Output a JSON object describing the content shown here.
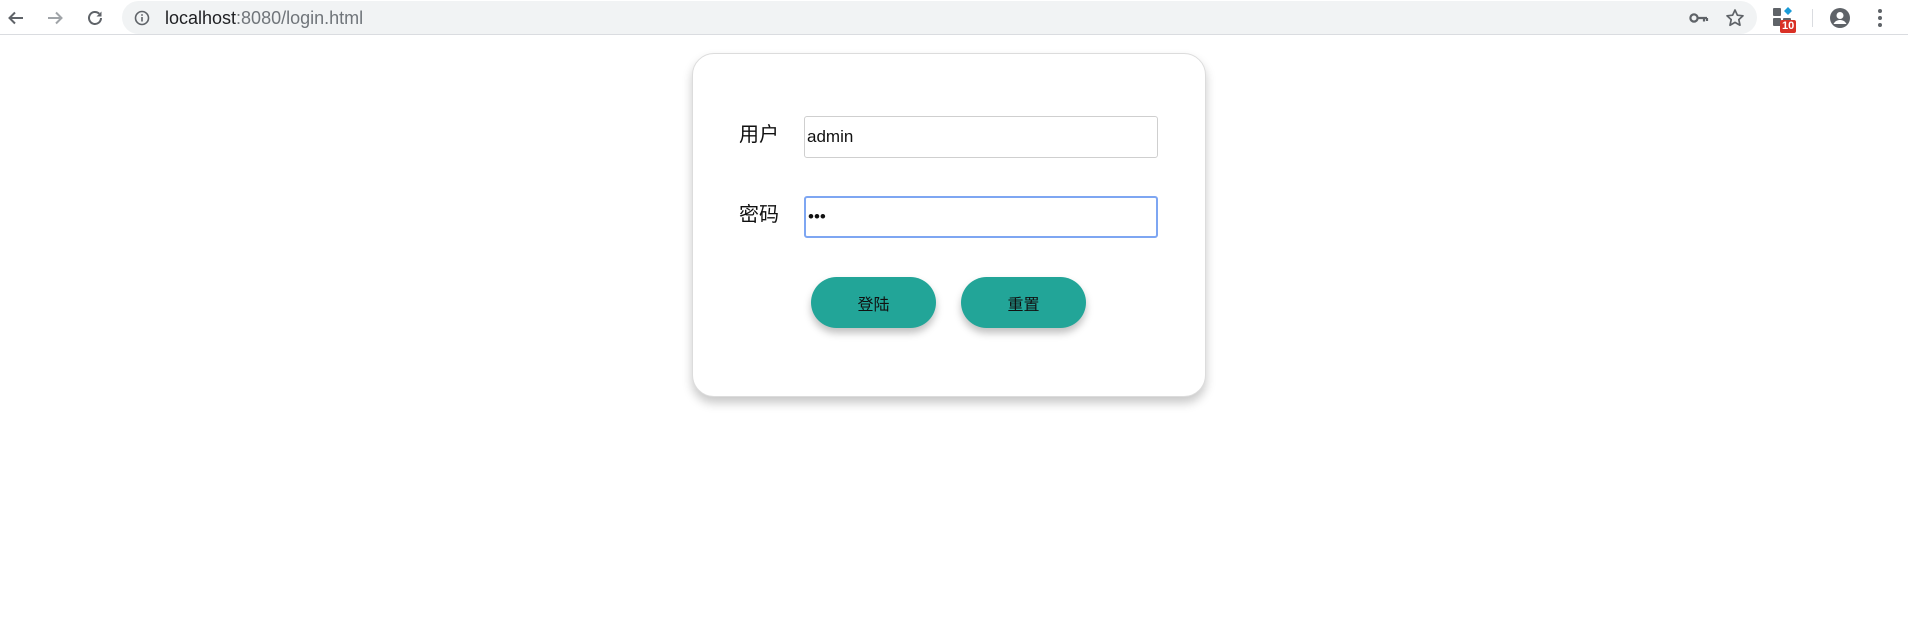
{
  "browser": {
    "url_host": "localhost",
    "url_rest": ":8080/login.html",
    "extension_badge": "10",
    "icons": [
      "back-arrow-icon",
      "forward-arrow-icon",
      "reload-icon",
      "info-icon",
      "key-icon",
      "star-icon",
      "extension-icon",
      "profile-icon",
      "menu-icon"
    ]
  },
  "login": {
    "username_label": "用户",
    "username_value": "admin",
    "password_label": "密码",
    "password_mask": "•••",
    "login_button": "登陆",
    "reset_button": "重置"
  },
  "colors": {
    "button": "#22a598",
    "focus_border": "#7ea6f2"
  }
}
